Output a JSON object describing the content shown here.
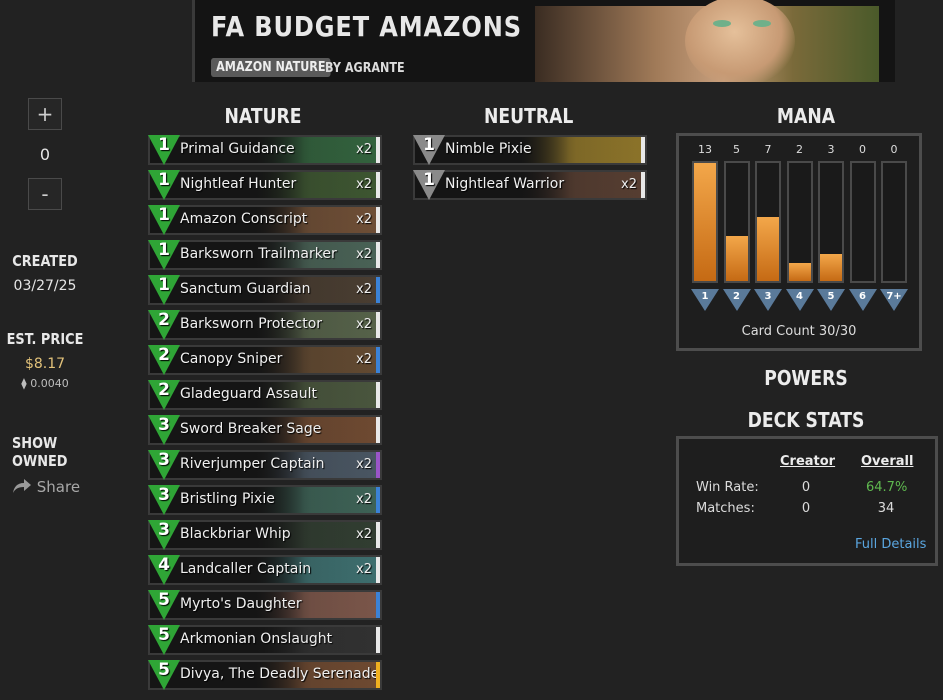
{
  "deck": {
    "title": "FA BUDGET AMAZONS",
    "tag": "AMAZON NATURE",
    "author": "BY AGRANTE"
  },
  "sidebar": {
    "plus": "+",
    "count": "0",
    "minus": "-",
    "created_label": "CREATED",
    "created_value": "03/27/25",
    "price_label": "EST. PRICE",
    "price_value": "$8.17",
    "price_eth": "⧫ 0.0040",
    "show_owned": "SHOW OWNED",
    "share": "Share"
  },
  "sections": {
    "nature": "NATURE",
    "neutral": "NEUTRAL",
    "mana": "MANA",
    "powers": "POWERS",
    "deck_stats": "DECK STATS"
  },
  "nature_cards": [
    {
      "cost": "1",
      "name": "Primal Guidance",
      "qty": "x2",
      "rarity": "#e8e8e8",
      "art": "#3c7a4a"
    },
    {
      "cost": "1",
      "name": "Nightleaf Hunter",
      "qty": "x2",
      "rarity": "#e8e8e8",
      "art": "#4a6a3a"
    },
    {
      "cost": "1",
      "name": "Amazon Conscript",
      "qty": "x2",
      "rarity": "#e8e8e8",
      "art": "#8a6040"
    },
    {
      "cost": "1",
      "name": "Barksworn Trailmarker",
      "qty": "x2",
      "rarity": "#e8e8e8",
      "art": "#5a7a6a"
    },
    {
      "cost": "1",
      "name": "Sanctum Guardian",
      "qty": "x2",
      "rarity": "#3b82d6",
      "art": "#5a4a3a"
    },
    {
      "cost": "2",
      "name": "Barksworn Protector",
      "qty": "x2",
      "rarity": "#e8e8e8",
      "art": "#6a7a5a"
    },
    {
      "cost": "2",
      "name": "Canopy Sniper",
      "qty": "x2",
      "rarity": "#3b82d6",
      "art": "#7a5a3a"
    },
    {
      "cost": "2",
      "name": "Gladeguard Assault",
      "qty": "",
      "rarity": "#e8e8e8",
      "art": "#5a6a4a"
    },
    {
      "cost": "3",
      "name": "Sword Breaker Sage",
      "qty": "",
      "rarity": "#e8e8e8",
      "art": "#8a5a3a"
    },
    {
      "cost": "3",
      "name": "Riverjumper Captain",
      "qty": "x2",
      "rarity": "#9a55c8",
      "art": "#5a6a7a"
    },
    {
      "cost": "3",
      "name": "Bristling Pixie",
      "qty": "x2",
      "rarity": "#3b82d6",
      "art": "#4a7a6a"
    },
    {
      "cost": "3",
      "name": "Blackbriar Whip",
      "qty": "x2",
      "rarity": "#e8e8e8",
      "art": "#3a4a3a"
    },
    {
      "cost": "4",
      "name": "Landcaller Captain",
      "qty": "x2",
      "rarity": "#e8e8e8",
      "art": "#4a8a8a"
    },
    {
      "cost": "5",
      "name": "Myrto's Daughter",
      "qty": "",
      "rarity": "#3b82d6",
      "art": "#9a6a5a"
    },
    {
      "cost": "5",
      "name": "Arkmonian Onslaught",
      "qty": "",
      "rarity": "#e8e8e8",
      "art": "#3a3a3a"
    },
    {
      "cost": "5",
      "name": "Divya, The Deadly Serenade",
      "qty": "",
      "rarity": "#f0b020",
      "art": "#8a5a3a"
    }
  ],
  "neutral_cards": [
    {
      "cost": "1",
      "name": "Nimble Pixie",
      "qty": "",
      "rarity": "#e8e8e8",
      "art": "#b09030"
    },
    {
      "cost": "1",
      "name": "Nightleaf Warrior",
      "qty": "x2",
      "rarity": "#e8e8e8",
      "art": "#6a4a3a"
    }
  ],
  "mana": {
    "counts": [
      "13",
      "5",
      "7",
      "2",
      "3",
      "0",
      "0"
    ],
    "labels": [
      "1",
      "2",
      "3",
      "4",
      "5",
      "6",
      "7+"
    ],
    "max": 13,
    "card_count": "Card Count 30/30"
  },
  "stats": {
    "col_creator": "Creator",
    "col_overall": "Overall",
    "win_rate_label": "Win Rate:",
    "win_rate_creator": "0",
    "win_rate_overall": "64.7%",
    "matches_label": "Matches:",
    "matches_creator": "0",
    "matches_overall": "34",
    "full_details": "Full Details"
  },
  "colors": {
    "background": "#222222",
    "nature_gem": "#2fa536",
    "neutral_gem": "#8a8a8a",
    "mana_bar": "#e08a2a",
    "win_rate": "#5fb84f",
    "link": "#5aa6e0"
  }
}
